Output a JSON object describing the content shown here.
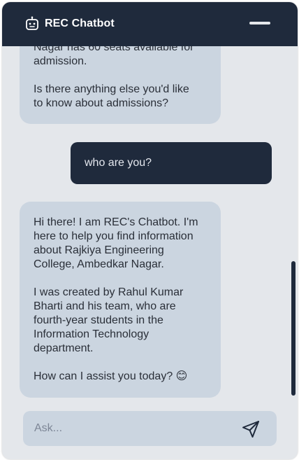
{
  "header": {
    "title": "REC Chatbot",
    "icon": "robot-icon",
    "menu_icon": "menu-icon",
    "background": "#1f2a3c"
  },
  "messages": [
    {
      "role": "bot",
      "text": "Nagar has 60 seats available for\nadmission.\n\nIs there anything else you'd like\nto know about admissions?"
    },
    {
      "role": "user",
      "text": "who are you?"
    },
    {
      "role": "bot",
      "text": "Hi there! I am REC's Chatbot. I'm\nhere to help you find information\nabout Rajkiya Engineering\nCollege, Ambedkar Nagar.\n\nI was created by Rahul Kumar\nBharti and his team, who are\nfourth-year students in the\nInformation Technology\ndepartment.\n\nHow can I assist you today? 😊"
    }
  ],
  "input": {
    "placeholder": "Ask...",
    "value": "",
    "send_icon": "send-icon"
  },
  "colors": {
    "panel": "#e4e7eb",
    "bot_bubble": "#cbd5e0",
    "user_bubble": "#1f2a3c",
    "accent": "#1f2a3c"
  }
}
